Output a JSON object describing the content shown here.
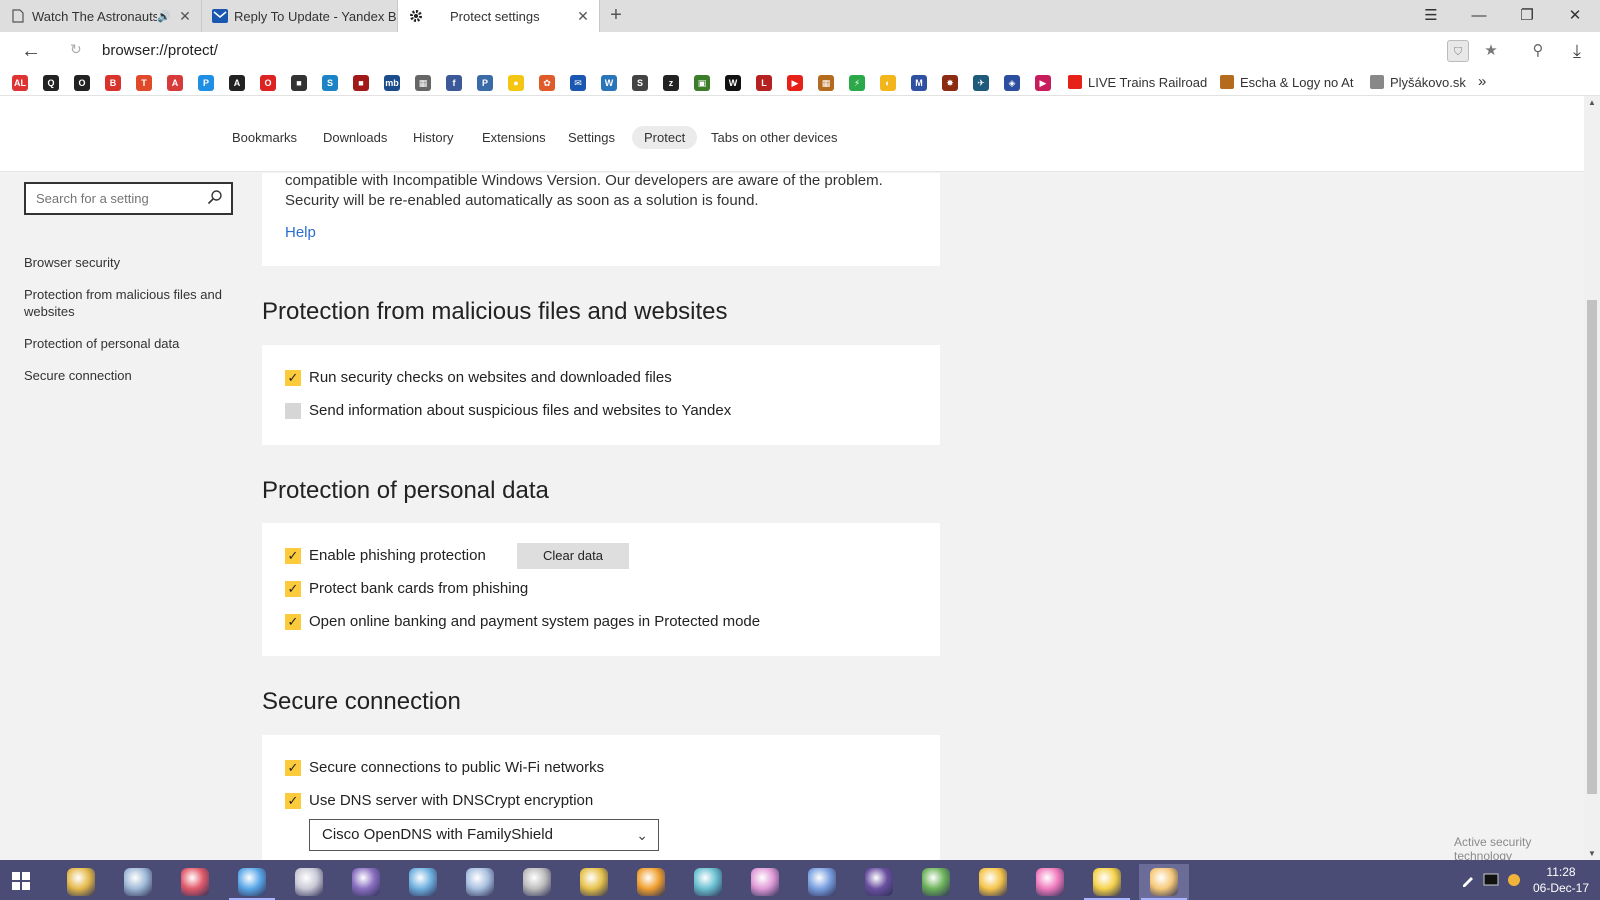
{
  "tabs": [
    {
      "title": "Watch The Astronauts",
      "audio": true,
      "icon": "document-icon"
    },
    {
      "title": "Reply To Update - Yandex Br",
      "audio": false,
      "icon": "envelope-icon"
    },
    {
      "title": "Protect settings",
      "audio": false,
      "icon": "gear-icon",
      "active": true
    }
  ],
  "address": {
    "url": "browser://protect/"
  },
  "bookmarks": [
    {
      "label": "AL",
      "color": "#d33"
    },
    {
      "label": "Q",
      "color": "#222"
    },
    {
      "label": "O",
      "color": "#222"
    },
    {
      "label": "B",
      "color": "#d8342c"
    },
    {
      "label": "T",
      "color": "#e04a2a"
    },
    {
      "label": "A",
      "color": "#d73a3a"
    },
    {
      "label": "P",
      "color": "#1f8fe5"
    },
    {
      "label": "A",
      "color": "#222"
    },
    {
      "label": "O",
      "color": "#d22"
    },
    {
      "label": "■",
      "color": "#333"
    },
    {
      "label": "S",
      "color": "#1c83c7"
    },
    {
      "label": "■",
      "color": "#a01818"
    },
    {
      "label": "mb",
      "color": "#1b4d8c"
    },
    {
      "label": "▦",
      "color": "#666"
    },
    {
      "label": "f",
      "color": "#3b5998"
    },
    {
      "label": "P",
      "color": "#3a6aa8"
    },
    {
      "label": "●",
      "color": "#f3c614"
    },
    {
      "label": "✿",
      "color": "#e05b2a"
    },
    {
      "label": "✉",
      "color": "#1a57b0"
    },
    {
      "label": "W",
      "color": "#2a74b8"
    },
    {
      "label": "S",
      "color": "#444"
    },
    {
      "label": "z",
      "color": "#222"
    },
    {
      "label": "▣",
      "color": "#3c7d2a"
    },
    {
      "label": "W",
      "color": "#111"
    },
    {
      "label": "L",
      "color": "#b52020"
    },
    {
      "label": "▶",
      "color": "#e62117"
    },
    {
      "label": "▦",
      "color": "#b56b1e"
    },
    {
      "label": "⚡",
      "color": "#2ba84a"
    },
    {
      "label": "◐",
      "color": "#f2b51b"
    },
    {
      "label": "M",
      "color": "#2e51a2"
    },
    {
      "label": "✸",
      "color": "#8a2b12"
    },
    {
      "label": "✈",
      "color": "#1e5a7a"
    },
    {
      "label": "◈",
      "color": "#2b4f9e"
    },
    {
      "label": "▶",
      "color": "#c71d5c"
    }
  ],
  "bookmark_texts": [
    {
      "label": "LIVE Trains Railroad",
      "icon": "youtube-icon"
    },
    {
      "label": "Escha & Logy no At",
      "icon": "image-icon"
    },
    {
      "label": "Plyšákovo.sk",
      "icon": "document-icon"
    }
  ],
  "settings_nav": [
    "Bookmarks",
    "Downloads",
    "History",
    "Extensions",
    "Settings",
    "Protect",
    "Tabs on other devices"
  ],
  "sidebar": {
    "search_placeholder": "Search for a setting",
    "links": [
      "Browser security",
      "Protection from malicious files and websites",
      "Protection of personal data",
      "Secure connection"
    ]
  },
  "warning": {
    "line1": "compatible with Incompatible Windows Version. Our developers are aware of the problem.",
    "line2": "Security will be re-enabled automatically as soon as a solution is found.",
    "help": "Help"
  },
  "sections": {
    "malicious": {
      "title": "Protection from malicious files and websites",
      "items": [
        {
          "label": "Run security checks on websites and downloaded files",
          "checked": true
        },
        {
          "label": "Send information about suspicious files and websites to Yandex",
          "checked": false
        }
      ]
    },
    "personal": {
      "title": "Protection of personal data",
      "items": [
        {
          "label": "Enable phishing protection",
          "checked": true
        },
        {
          "label": "Protect bank cards from phishing",
          "checked": true
        },
        {
          "label": "Open online banking and payment system pages in Protected mode",
          "checked": true
        }
      ],
      "clear_button": "Clear data"
    },
    "secure": {
      "title": "Secure connection",
      "items": [
        {
          "label": "Secure connections to public Wi-Fi networks",
          "checked": true
        },
        {
          "label": "Use DNS server with DNSCrypt encryption",
          "checked": true
        }
      ],
      "dns_selected": "Cisco OpenDNS with FamilyShield"
    }
  },
  "active_security": "Active security technology",
  "clock": {
    "time": "11:28",
    "date": "06-Dec-17"
  },
  "taskbar_apps": [
    "#e4b94a",
    "#9fb9d7",
    "#e25a6a",
    "#5aa8e8",
    "#c9c9d6",
    "#8a6fc1",
    "#6fb0df",
    "#a8c0e0",
    "#bdbdbd",
    "#e6c14a",
    "#f0a030",
    "#6ac1d1",
    "#e09ad8",
    "#7aa0e0",
    "#6a4fa0",
    "#6db35a",
    "#f5c54a",
    "#f07bbd",
    "#f5d24a",
    "#f6c978"
  ],
  "colors": {
    "accent_checkbox": "#fccb3c",
    "link": "#2a6ecf",
    "taskbar": "#4a4c75"
  }
}
